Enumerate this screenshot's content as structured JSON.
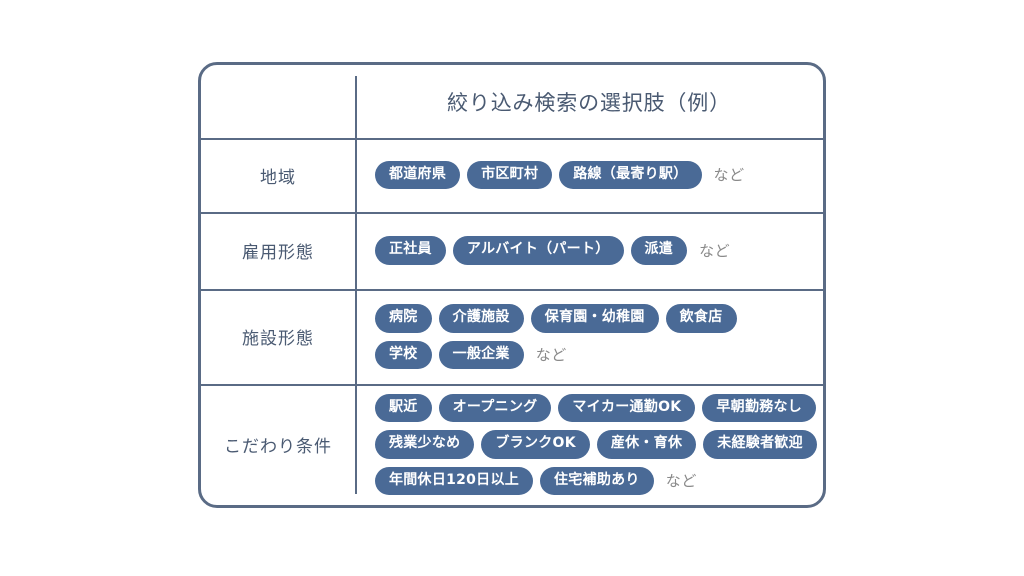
{
  "colors": {
    "card_border": "#5a6b85",
    "divider": "#5a6b85",
    "pill_fill": "#4a6a96",
    "pill_text": "#ffffff",
    "label_text": "#4a5a72",
    "etc_text": "#8a8a8a",
    "background": "#ffffff"
  },
  "table": {
    "header": {
      "title": "絞り込み検索の選択肢（例）"
    },
    "etc_label": "など",
    "rows": [
      {
        "label": "地域",
        "lines": [
          {
            "tags": [
              "都道府県",
              "市区町村",
              "路線（最寄り駅）"
            ],
            "etc": "など"
          }
        ]
      },
      {
        "label": "雇用形態",
        "lines": [
          {
            "tags": [
              "正社員",
              "アルバイト（パート）",
              "派遣"
            ],
            "etc": "など"
          }
        ]
      },
      {
        "label": "施設形態",
        "lines": [
          {
            "tags": [
              "病院",
              "介護施設",
              "保育園・幼稚園",
              "飲食店"
            ],
            "etc": ""
          },
          {
            "tags": [
              "学校",
              "一般企業"
            ],
            "etc": "など"
          }
        ]
      },
      {
        "label": "こだわり条件",
        "lines": [
          {
            "tags": [
              "駅近",
              "オープニング",
              "マイカー通勤OK",
              "早朝勤務なし"
            ],
            "etc": ""
          },
          {
            "tags": [
              "残業少なめ",
              "ブランクOK",
              "産休・育休",
              "未経験者歓迎"
            ],
            "etc": ""
          },
          {
            "tags": [
              "年間休日120日以上",
              "住宅補助あり"
            ],
            "etc": "など"
          }
        ]
      }
    ]
  }
}
